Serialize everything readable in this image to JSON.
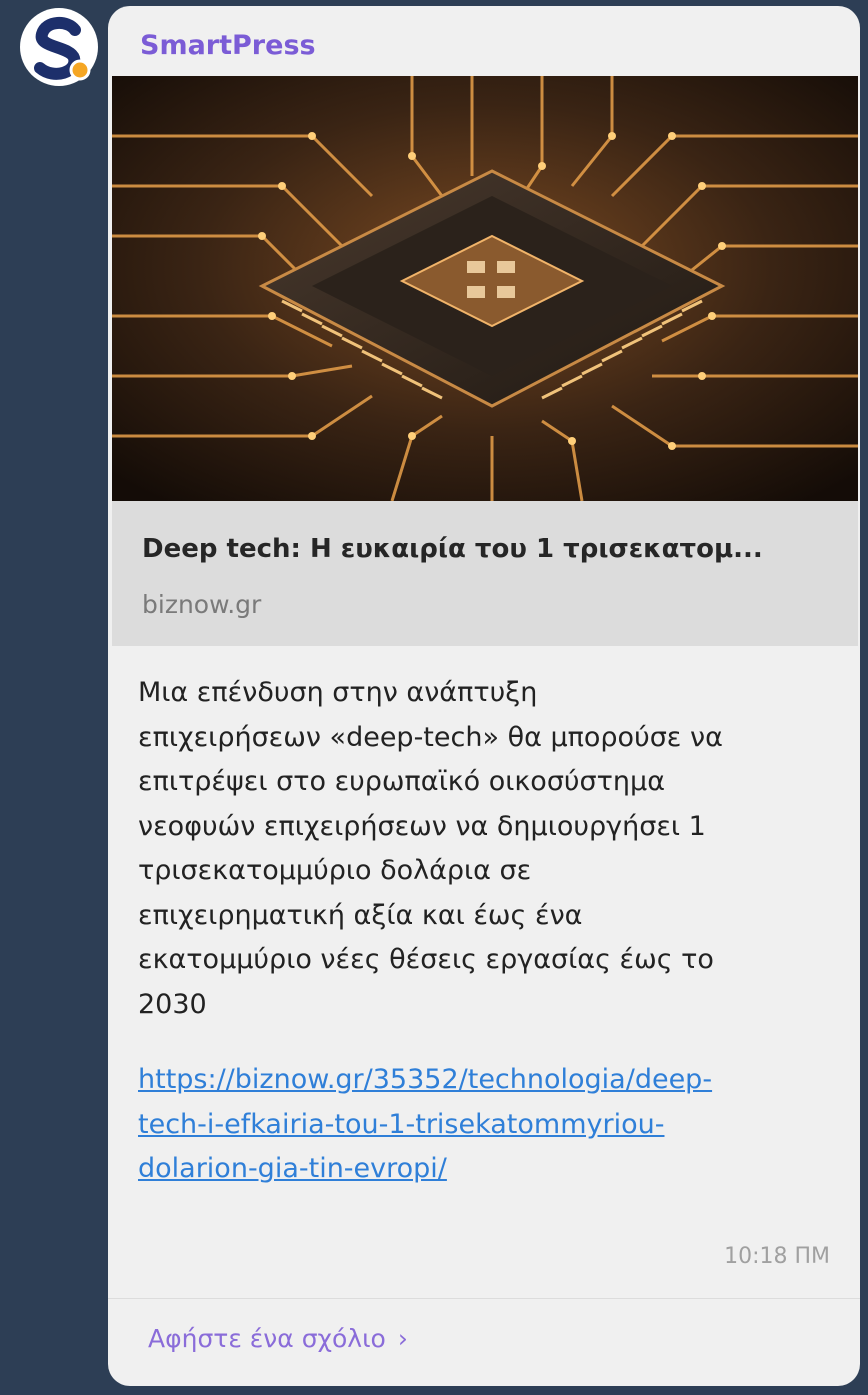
{
  "sender": "SmartPress",
  "preview": {
    "title": "Deep tech: Η ευκαιρία του 1 τρισεκατομ...",
    "domain": "biznow.gr",
    "image_icon": "circuit-chip-image"
  },
  "message": {
    "lines": [
      "Μια επένδυση στην ανάπτυξη",
      "επιχειρήσεων «deep-tech» θα μπορούσε να",
      "επιτρέψει στο ευρωπαϊκό οικοσύστημα",
      "νεοφυών επιχειρήσεων να δημιουργήσει 1",
      "τρισεκατομμύριο δολάρια σε",
      "επιχειρηματική αξία και έως ένα",
      "εκατομμύριο νέες θέσεις εργασίας έως το",
      "2030"
    ],
    "link_lines": [
      "https://biznow.gr/35352/technologia/deep-",
      "tech-i-efkairia-tou-1-trisekatommyriou-",
      "dolarion-gia-tin-evropi/"
    ],
    "time": "10:18 ΠΜ"
  },
  "comment": {
    "label": "Αφήστε ένα σχόλιο",
    "chevron": "›"
  },
  "colors": {
    "background": "#2d3e55",
    "bubble": "#f0f0f0",
    "sender": "#7b5cd6",
    "link": "#2f7fd8",
    "comment": "#8a6cd9"
  }
}
